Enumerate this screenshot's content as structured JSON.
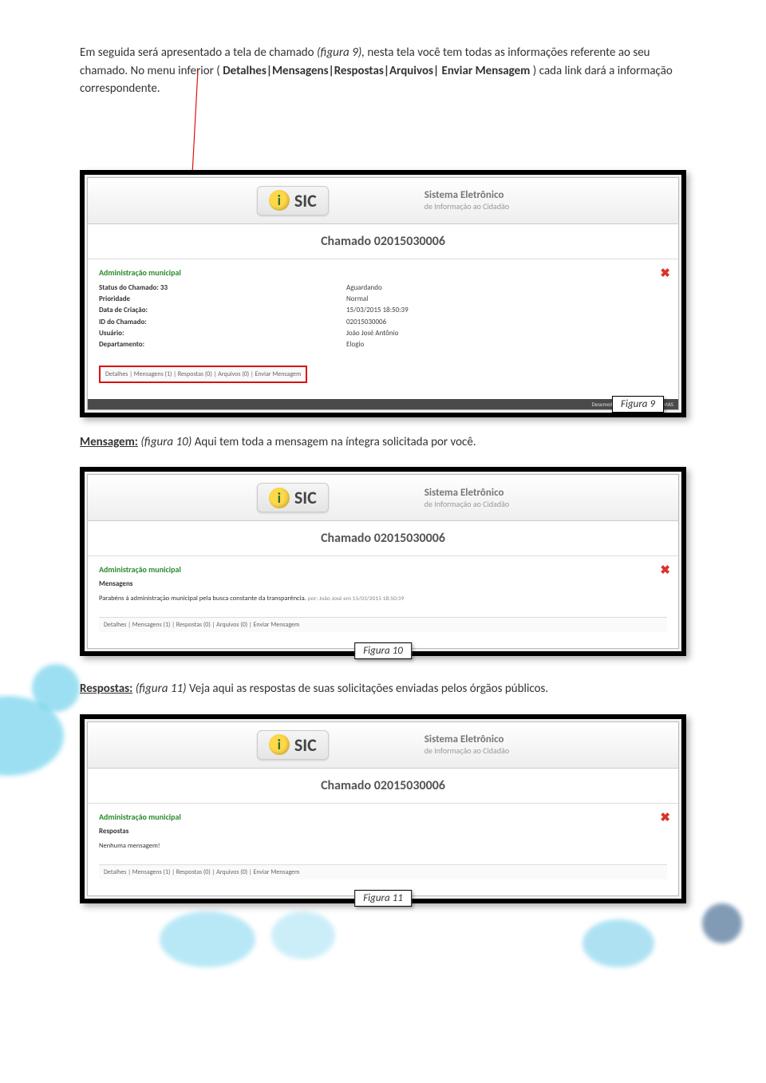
{
  "intro": {
    "p1a": "Em seguida será apresentado a tela de chamado ",
    "p1b": "(figura 9),",
    "p1c": " nesta tela você tem todas as informações referente ao seu chamado. No menu inferior (",
    "p1d": "Detalhes|Mensagens|Respostas|Arquivos| Enviar Mensagem",
    "p1e": ") cada link dará a informação correspondente."
  },
  "sic": {
    "brand": "SIC",
    "sys1": "Sistema Eletrônico",
    "sys2": "de Informação ao Cidadão"
  },
  "chamado": "Chamado 02015030006",
  "admin": "Administração municipal",
  "close": "✖",
  "fields": {
    "k1": "Status do Chamado: 33",
    "v1": "Aguardando",
    "k2": "Prioridade",
    "v2": "Normal",
    "k3": "Data de Criação:",
    "v3": "15/03/2015 18:50:39",
    "k4": "ID do Chamado:",
    "v4": "02015030006",
    "k5": "Usuário:",
    "v5": "João José Antônio",
    "k6": "Departamento:",
    "v6": "Elogio"
  },
  "tabs": "Detalhes  |  Mensagens (1)  |  Respostas (0)  |  Arquivos (0)  |  Enviar Mensagem",
  "footer": "Desenvolvido por PLUGIN SISTEMAS",
  "fig9": "Figura 9",
  "msg_intro_a": "Mensagem:",
  "msg_intro_b": " (figura 10)",
  "msg_intro_c": " Aqui tem toda a mensagem na íntegra solicitada por você.",
  "fig10_panel": {
    "heading": "Mensagens",
    "msg": "Parabéns á administração municipal pela busca constante da transparência.",
    "by": "por: João José em 15/03/2015 18:50:39"
  },
  "fig10": "Figura 10",
  "resp_intro_a": "Respostas:",
  "resp_intro_b": " (figura 11)",
  "resp_intro_c": " Veja aqui as respostas de suas solicitações enviadas pelos órgãos públicos.",
  "fig11_panel": {
    "heading": "Respostas",
    "msg": "Nenhuma mensagem!"
  },
  "fig11": "Figura 11"
}
